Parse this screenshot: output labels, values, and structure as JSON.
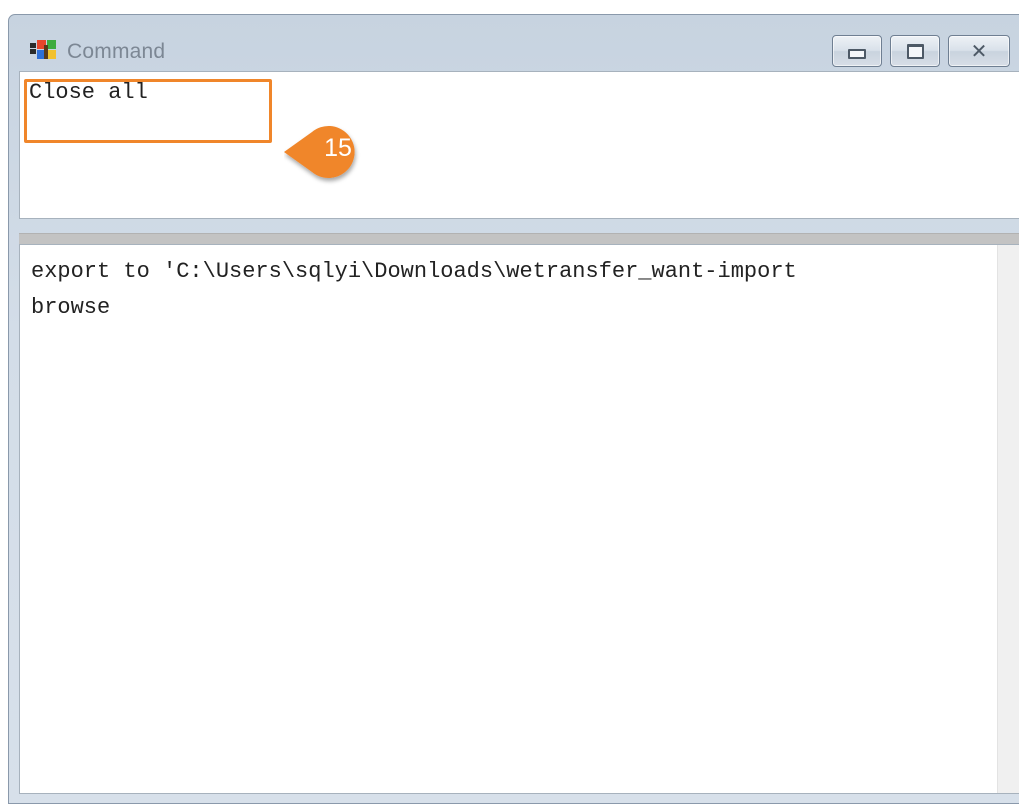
{
  "window": {
    "title": "Command",
    "controls": {
      "minimize_icon": "minimize-icon",
      "maximize_icon": "maximize-icon",
      "close_icon": "close-icon",
      "close_glyph": "✕"
    }
  },
  "command_input": {
    "value": "Close all"
  },
  "callout": {
    "number": "15",
    "color": "#f0862a"
  },
  "output": {
    "lines": [
      "export to 'C:\\Users\\sqlyi\\Downloads\\wetransfer_want-import",
      "browse"
    ]
  },
  "colors": {
    "highlight": "#f0862a",
    "titlebar": "#d3dde8",
    "splitter": "#c3c3c3"
  }
}
